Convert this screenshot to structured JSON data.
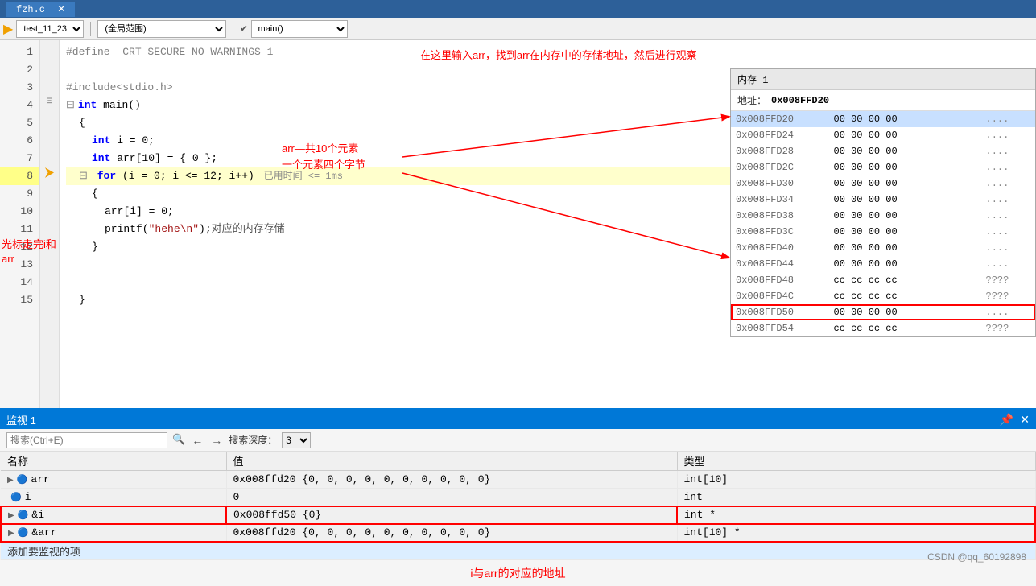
{
  "titleBar": {
    "filename": "fzh.c",
    "closeLabel": "✕"
  },
  "toolbar": {
    "fileSelector": "test_11_23",
    "scopeSelector": "(全局范围)",
    "functionSelector": "main()"
  },
  "codeLines": [
    {
      "num": 1,
      "indent": 0,
      "text": "#define _CRT_SECURE_NO_WARNINGS 1",
      "type": "macro"
    },
    {
      "num": 2,
      "indent": 0,
      "text": "",
      "type": "empty"
    },
    {
      "num": 3,
      "indent": 0,
      "text": "#include<stdio.h>",
      "type": "include"
    },
    {
      "num": 4,
      "indent": 0,
      "text": "int main()",
      "type": "code",
      "hasExpand": true
    },
    {
      "num": 5,
      "indent": 0,
      "text": "{",
      "type": "code"
    },
    {
      "num": 6,
      "indent": 1,
      "text": "int i = 0;",
      "type": "code"
    },
    {
      "num": 7,
      "indent": 1,
      "text": "int arr[10] = { 0 };",
      "type": "code"
    },
    {
      "num": 8,
      "indent": 1,
      "text": "for (i = 0; i <= 12; i++)",
      "type": "code",
      "hasExpand": true,
      "timeHint": "已用时间 <= 1ms",
      "isCurrentLine": true
    },
    {
      "num": 9,
      "indent": 1,
      "text": "{",
      "type": "code"
    },
    {
      "num": 10,
      "indent": 2,
      "text": "arr[i] = 0;",
      "type": "code"
    },
    {
      "num": 11,
      "indent": 2,
      "text": "printf(\"hehe\\n\");对应的内存存储",
      "type": "code"
    },
    {
      "num": 12,
      "indent": 1,
      "text": "}",
      "type": "code"
    },
    {
      "num": 13,
      "indent": 0,
      "text": "",
      "type": "empty"
    },
    {
      "num": 14,
      "indent": 0,
      "text": "",
      "type": "empty"
    },
    {
      "num": 15,
      "indent": 1,
      "text": "}",
      "type": "code"
    }
  ],
  "memoryPanel": {
    "title": "内存 1",
    "addressLabel": "地址：",
    "addressValue": "0x008FFD20",
    "rows": [
      {
        "addr": "0x008FFD20",
        "bytes": "00 00 00 00",
        "chars": "....",
        "highlighted": true
      },
      {
        "addr": "0x008FFD24",
        "bytes": "00 00 00 00",
        "chars": "....",
        "highlighted": false
      },
      {
        "addr": "0x008FFD28",
        "bytes": "00 00 00 00",
        "chars": "....",
        "highlighted": false
      },
      {
        "addr": "0x008FFD2C",
        "bytes": "00 00 00 00",
        "chars": "....",
        "highlighted": false
      },
      {
        "addr": "0x008FFD30",
        "bytes": "00 00 00 00",
        "chars": "....",
        "highlighted": false
      },
      {
        "addr": "0x008FFD34",
        "bytes": "00 00 00 00",
        "chars": "....",
        "highlighted": false
      },
      {
        "addr": "0x008FFD38",
        "bytes": "00 00 00 00",
        "chars": "....",
        "highlighted": false
      },
      {
        "addr": "0x008FFD3C",
        "bytes": "00 00 00 00",
        "chars": "....",
        "highlighted": false
      },
      {
        "addr": "0x008FFD40",
        "bytes": "00 00 00 00",
        "chars": "....",
        "highlighted": false
      },
      {
        "addr": "0x008FFD44",
        "bytes": "00 00 00 00",
        "chars": "....",
        "highlighted": false
      },
      {
        "addr": "0x008FFD48",
        "bytes": "cc cc cc cc",
        "chars": "????",
        "highlighted": false
      },
      {
        "addr": "0x008FFD4C",
        "bytes": "cc cc cc cc",
        "chars": "????",
        "highlighted": false
      },
      {
        "addr": "0x008FFD50",
        "bytes": "00 00 00 00",
        "chars": "....",
        "highlighted": false,
        "redBorder": true
      },
      {
        "addr": "0x008FFD54",
        "bytes": "cc cc cc cc",
        "chars": "????",
        "highlighted": false
      }
    ]
  },
  "annotations": {
    "topRight": "在这里输入arr，找到arr在内存中的存储地址，然后进行观察",
    "arrLabel": "arr—共10个元素\n一个元素四个字节",
    "leftLabel": "光标走完i和arr",
    "bottomLabel": "i与arr的对应的地址"
  },
  "watchPanel": {
    "title": "监视 1",
    "searchPlaceholder": "搜索(Ctrl+E)",
    "depthLabel": "搜索深度：",
    "depthValue": "3",
    "columns": [
      "名称",
      "值",
      "类型"
    ],
    "rows": [
      {
        "name": "arr",
        "value": "0x008ffd20 {0, 0, 0, 0, 0, 0, 0, 0, 0, 0}",
        "type": "int[10]",
        "hasExpand": true,
        "icon": true
      },
      {
        "name": "i",
        "value": "0",
        "type": "int",
        "hasExpand": false,
        "icon": true
      },
      {
        "name": "&i",
        "value": "0x008ffd50 {0}",
        "type": "int *",
        "hasExpand": true,
        "icon": true,
        "redBox": true
      },
      {
        "name": "&arr",
        "value": "0x008ffd20 {0, 0, 0, 0, 0, 0, 0, 0, 0, 0}",
        "type": "int[10] *",
        "hasExpand": true,
        "icon": true,
        "redBox": true
      }
    ],
    "addRowLabel": "添加要监视的项"
  },
  "watermark": "CSDN @qq_60192898"
}
